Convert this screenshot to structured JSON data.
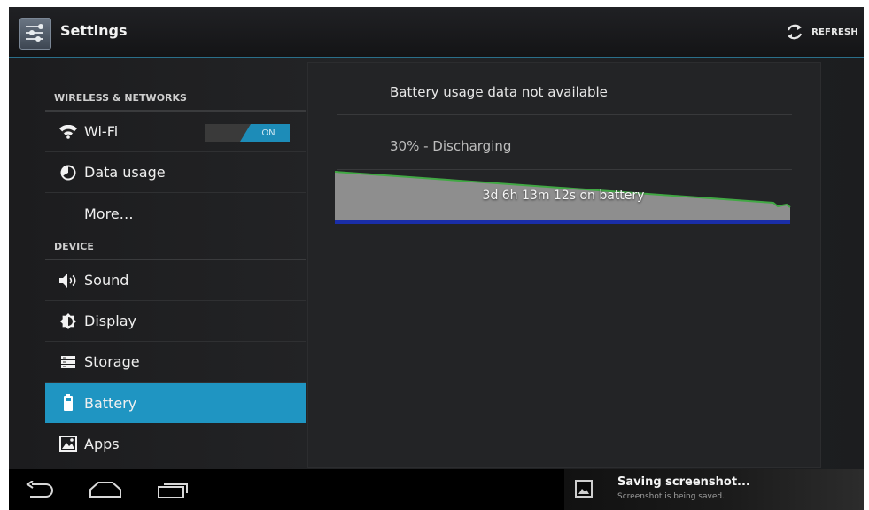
{
  "action_bar": {
    "title": "Settings",
    "refresh_label": "REFRESH"
  },
  "sidebar": {
    "sections": [
      {
        "header": "WIRELESS & NETWORKS",
        "items": [
          {
            "label": "Wi-Fi",
            "icon": "wifi-icon",
            "toggle": "ON"
          },
          {
            "label": "Data usage",
            "icon": "data-usage-icon"
          },
          {
            "label": "More…",
            "icon": ""
          }
        ]
      },
      {
        "header": "DEVICE",
        "items": [
          {
            "label": "Sound",
            "icon": "speaker-icon"
          },
          {
            "label": "Display",
            "icon": "brightness-icon"
          },
          {
            "label": "Storage",
            "icon": "storage-icon"
          },
          {
            "label": "Battery",
            "icon": "battery-icon",
            "selected": true
          },
          {
            "label": "Apps",
            "icon": "apps-icon"
          }
        ]
      }
    ]
  },
  "battery": {
    "usage_message": "Battery usage data not available",
    "status": "30% - Discharging",
    "graph_label": "3d 6h 13m 12s on battery",
    "level_percent": 30
  },
  "notification": {
    "title": "Saving screenshot...",
    "subtitle": "Screenshot is being saved."
  },
  "colors": {
    "accent": "#1f95c2",
    "graph_fill": "#8e8e8e",
    "graph_line": "#41a844",
    "graph_baseline": "#1a2ea8"
  }
}
